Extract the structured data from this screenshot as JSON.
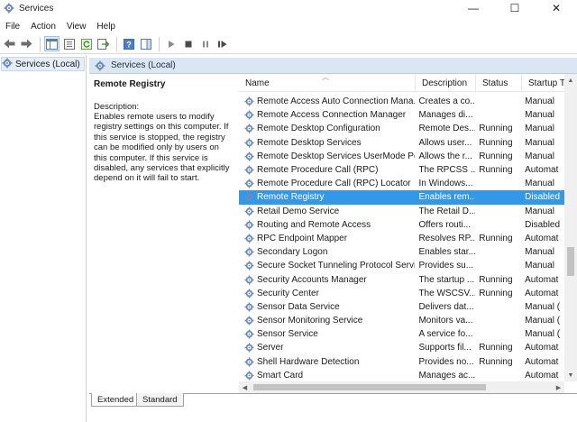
{
  "window": {
    "title": "Services",
    "controls": {
      "minimize": "—",
      "maximize": "☐",
      "close": "✕"
    }
  },
  "menu": [
    "File",
    "Action",
    "View",
    "Help"
  ],
  "tree": {
    "root": "Services (Local)"
  },
  "pane_header": "Services (Local)",
  "description": {
    "service_name": "Remote Registry",
    "label": "Description:",
    "text": "Enables remote users to modify registry settings on this computer. If this service is stopped, the registry can be modified only by users on this computer. If this service is disabled, any services that explicitly depend on it will fail to start."
  },
  "columns": [
    "Name",
    "Description",
    "Status",
    "Startup Ty"
  ],
  "rows": [
    {
      "name": "Remote Access Auto Connection Mana...",
      "description": "Creates a co...",
      "status": "",
      "startup": "Manual"
    },
    {
      "name": "Remote Access Connection Manager",
      "description": "Manages di...",
      "status": "",
      "startup": "Manual"
    },
    {
      "name": "Remote Desktop Configuration",
      "description": "Remote Des...",
      "status": "Running",
      "startup": "Manual"
    },
    {
      "name": "Remote Desktop Services",
      "description": "Allows user...",
      "status": "Running",
      "startup": "Manual"
    },
    {
      "name": "Remote Desktop Services UserMode Por...",
      "description": "Allows the r...",
      "status": "Running",
      "startup": "Manual"
    },
    {
      "name": "Remote Procedure Call (RPC)",
      "description": "The RPCSS ...",
      "status": "Running",
      "startup": "Automat"
    },
    {
      "name": "Remote Procedure Call (RPC) Locator",
      "description": "In Windows...",
      "status": "",
      "startup": "Manual"
    },
    {
      "name": "Remote Registry",
      "description": "Enables rem...",
      "status": "",
      "startup": "Disabled",
      "selected": true
    },
    {
      "name": "Retail Demo Service",
      "description": "The Retail D...",
      "status": "",
      "startup": "Manual"
    },
    {
      "name": "Routing and Remote Access",
      "description": "Offers routi...",
      "status": "",
      "startup": "Disabled"
    },
    {
      "name": "RPC Endpoint Mapper",
      "description": "Resolves RP...",
      "status": "Running",
      "startup": "Automat"
    },
    {
      "name": "Secondary Logon",
      "description": "Enables star...",
      "status": "",
      "startup": "Manual"
    },
    {
      "name": "Secure Socket Tunneling Protocol Service",
      "description": "Provides su...",
      "status": "",
      "startup": "Manual"
    },
    {
      "name": "Security Accounts Manager",
      "description": "The startup ...",
      "status": "Running",
      "startup": "Automat"
    },
    {
      "name": "Security Center",
      "description": "The WSCSV...",
      "status": "Running",
      "startup": "Automat"
    },
    {
      "name": "Sensor Data Service",
      "description": "Delivers dat...",
      "status": "",
      "startup": "Manual ("
    },
    {
      "name": "Sensor Monitoring Service",
      "description": "Monitors va...",
      "status": "",
      "startup": "Manual ("
    },
    {
      "name": "Sensor Service",
      "description": "A service fo...",
      "status": "",
      "startup": "Manual ("
    },
    {
      "name": "Server",
      "description": "Supports fil...",
      "status": "Running",
      "startup": "Automat"
    },
    {
      "name": "Shell Hardware Detection",
      "description": "Provides no...",
      "status": "Running",
      "startup": "Automat"
    },
    {
      "name": "Smart Card",
      "description": "Manages ac...",
      "status": "",
      "startup": "Automat"
    }
  ],
  "tabs": [
    "Extended",
    "Standard"
  ],
  "colors": {
    "selection": "#3399e6",
    "header_bg": "#dbe6f4",
    "gear": "#6d8bb3"
  }
}
